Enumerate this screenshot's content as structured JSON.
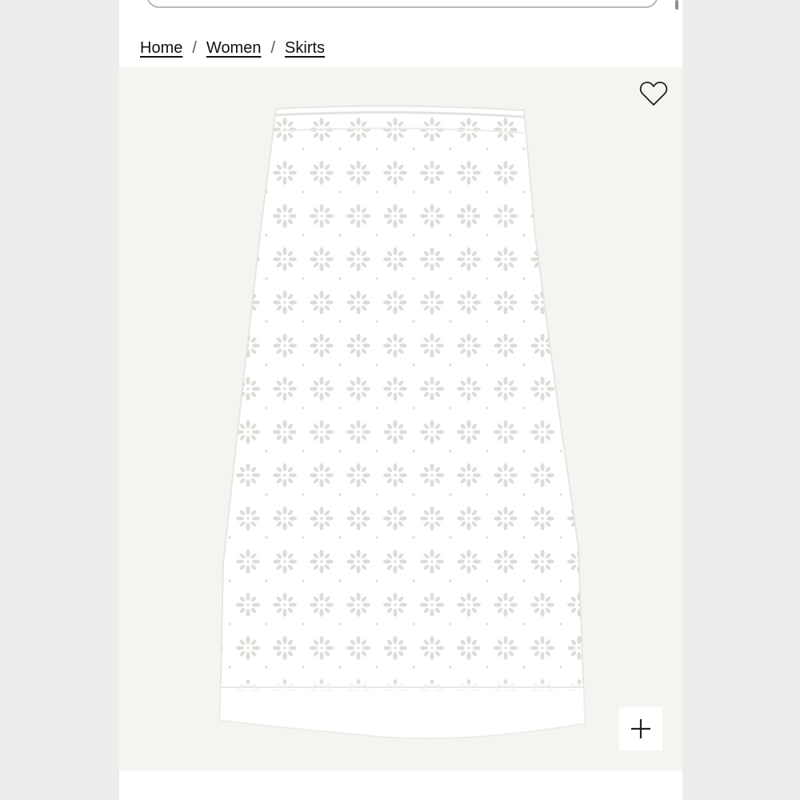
{
  "breadcrumb": {
    "items": [
      "Home",
      "Women",
      "Skirts"
    ],
    "separator": "/"
  },
  "product_image": {
    "subject": "white eyelet midi skirt",
    "background_color": "#f4f4f1",
    "garment_color": "#ffffff"
  },
  "icons": {
    "wishlist": "heart-icon",
    "zoom": "plus-icon"
  }
}
